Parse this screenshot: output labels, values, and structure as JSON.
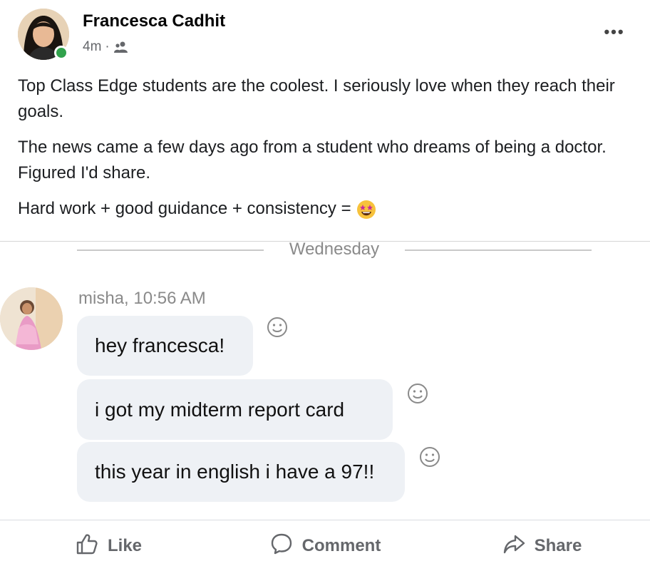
{
  "post": {
    "author": "Francesca Cadhit",
    "time": "4m",
    "separator": "·",
    "audience_icon": "friends-icon",
    "more_icon": "more-options-icon",
    "more_label": "•••",
    "paragraphs": [
      "Top Class Edge students are the coolest. I seriously love when they reach their goals.",
      "The news came a few days ago from a student who dreams of being a doctor. Figured I'd share.",
      "Hard work + good guidance + consistency ="
    ],
    "emoji": "star-struck-emoji"
  },
  "screenshot": {
    "day_label": "Wednesday",
    "sender_line": "misha, 10:56 AM",
    "messages": [
      "hey francesca!",
      "i got my midterm report card",
      "this year in english i have a 97!!"
    ],
    "react_icon": "smiley-react-icon"
  },
  "actions": {
    "like": "Like",
    "comment": "Comment",
    "share": "Share"
  },
  "colors": {
    "online": "#31a24c",
    "bubble": "#eef1f5",
    "secondary_text": "#65676b"
  }
}
